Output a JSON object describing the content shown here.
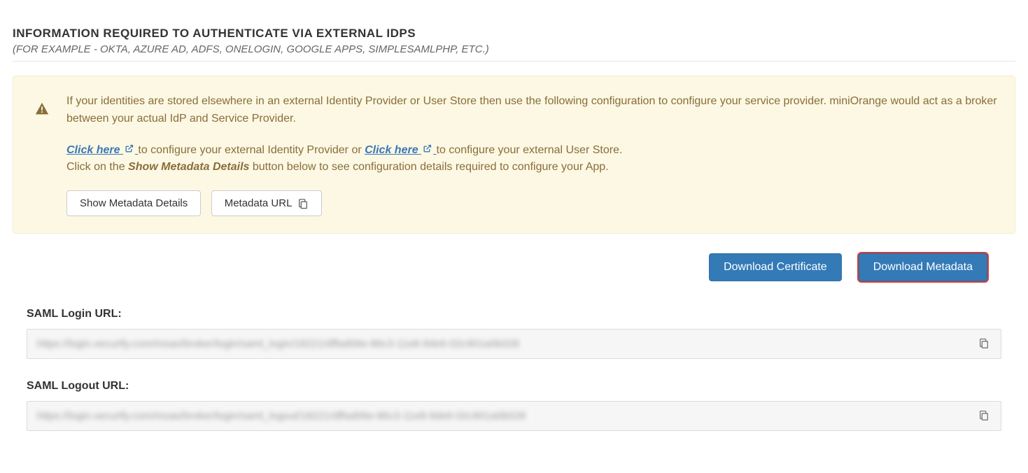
{
  "header": {
    "title": "INFORMATION REQUIRED TO AUTHENTICATE VIA EXTERNAL IDPS",
    "subtitle": "(FOR EXAMPLE - OKTA, AZURE AD, ADFS, ONELOGIN, GOOGLE APPS, SIMPLESAMLPHP, ETC.)"
  },
  "info": {
    "paragraph1": "If your identities are stored elsewhere in an external Identity Provider or User Store then use the following configuration to configure your service provider. miniOrange would act as a broker between your actual IdP and Service Provider.",
    "link1_text": "Click here",
    "paragraph2_mid": " to configure your external Identity Provider or ",
    "link2_text": "Click here",
    "paragraph2_end": " to configure your external User Store.",
    "paragraph3_pre": "Click on the ",
    "paragraph3_em": "Show Metadata Details",
    "paragraph3_post": " button below to see configuration details required to configure your App.",
    "buttons": {
      "show_metadata": "Show Metadata Details",
      "metadata_url": "Metadata URL"
    }
  },
  "downloads": {
    "cert": "Download Certificate",
    "meta": "Download Metadata"
  },
  "fields": {
    "login_label": "SAML Login URL:",
    "login_value": "https://login.xecurify.com/moas/broker/login/saml_login/18221/dffad06e-86c3-11e8-9de6-02c901a0b028",
    "logout_label": "SAML Logout URL:",
    "logout_value": "https://login.xecurify.com/moas/broker/login/saml_logout/18221/dffad06e-86c3-11e8-9de6-02c901a0b028"
  }
}
